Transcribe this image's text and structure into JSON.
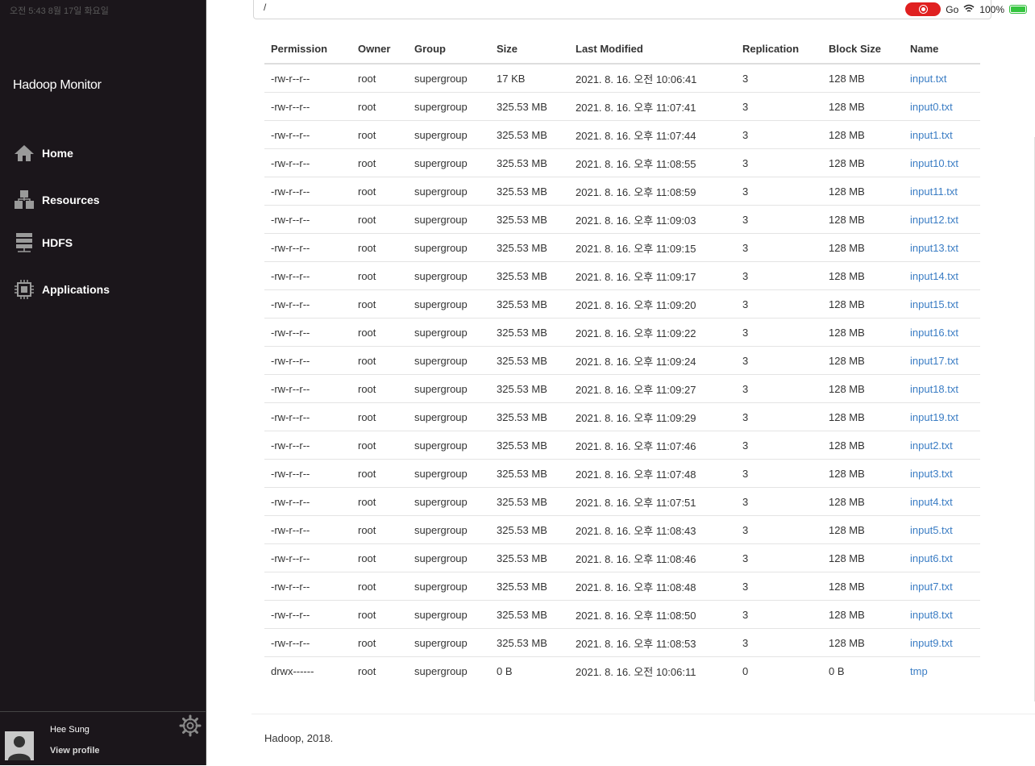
{
  "status_bar": {
    "time": "오전 5:43   8월 17일 화요일",
    "battery": "100%",
    "extra": "Go"
  },
  "sidebar": {
    "brand": "Hadoop Monitor",
    "items": [
      {
        "label": "Home",
        "icon": "home-icon"
      },
      {
        "label": "Resources",
        "icon": "cubes-icon"
      },
      {
        "label": "HDFS",
        "icon": "server-stack-icon"
      },
      {
        "label": "Applications",
        "icon": "chip-icon"
      }
    ],
    "profile": {
      "name": "Hee Sung",
      "link": "View profile"
    }
  },
  "path": "/",
  "table": {
    "headers": [
      "Permission",
      "Owner",
      "Group",
      "Size",
      "Last Modified",
      "Replication",
      "Block Size",
      "Name"
    ],
    "rows": [
      [
        "-rw-r--r--",
        "root",
        "supergroup",
        "17 KB",
        "2021. 8. 16. 오전 10:06:41",
        "3",
        "128 MB",
        "input.txt"
      ],
      [
        "-rw-r--r--",
        "root",
        "supergroup",
        "325.53 MB",
        "2021. 8. 16. 오후 11:07:41",
        "3",
        "128 MB",
        "input0.txt"
      ],
      [
        "-rw-r--r--",
        "root",
        "supergroup",
        "325.53 MB",
        "2021. 8. 16. 오후 11:07:44",
        "3",
        "128 MB",
        "input1.txt"
      ],
      [
        "-rw-r--r--",
        "root",
        "supergroup",
        "325.53 MB",
        "2021. 8. 16. 오후 11:08:55",
        "3",
        "128 MB",
        "input10.txt"
      ],
      [
        "-rw-r--r--",
        "root",
        "supergroup",
        "325.53 MB",
        "2021. 8. 16. 오후 11:08:59",
        "3",
        "128 MB",
        "input11.txt"
      ],
      [
        "-rw-r--r--",
        "root",
        "supergroup",
        "325.53 MB",
        "2021. 8. 16. 오후 11:09:03",
        "3",
        "128 MB",
        "input12.txt"
      ],
      [
        "-rw-r--r--",
        "root",
        "supergroup",
        "325.53 MB",
        "2021. 8. 16. 오후 11:09:15",
        "3",
        "128 MB",
        "input13.txt"
      ],
      [
        "-rw-r--r--",
        "root",
        "supergroup",
        "325.53 MB",
        "2021. 8. 16. 오후 11:09:17",
        "3",
        "128 MB",
        "input14.txt"
      ],
      [
        "-rw-r--r--",
        "root",
        "supergroup",
        "325.53 MB",
        "2021. 8. 16. 오후 11:09:20",
        "3",
        "128 MB",
        "input15.txt"
      ],
      [
        "-rw-r--r--",
        "root",
        "supergroup",
        "325.53 MB",
        "2021. 8. 16. 오후 11:09:22",
        "3",
        "128 MB",
        "input16.txt"
      ],
      [
        "-rw-r--r--",
        "root",
        "supergroup",
        "325.53 MB",
        "2021. 8. 16. 오후 11:09:24",
        "3",
        "128 MB",
        "input17.txt"
      ],
      [
        "-rw-r--r--",
        "root",
        "supergroup",
        "325.53 MB",
        "2021. 8. 16. 오후 11:09:27",
        "3",
        "128 MB",
        "input18.txt"
      ],
      [
        "-rw-r--r--",
        "root",
        "supergroup",
        "325.53 MB",
        "2021. 8. 16. 오후 11:09:29",
        "3",
        "128 MB",
        "input19.txt"
      ],
      [
        "-rw-r--r--",
        "root",
        "supergroup",
        "325.53 MB",
        "2021. 8. 16. 오후 11:07:46",
        "3",
        "128 MB",
        "input2.txt"
      ],
      [
        "-rw-r--r--",
        "root",
        "supergroup",
        "325.53 MB",
        "2021. 8. 16. 오후 11:07:48",
        "3",
        "128 MB",
        "input3.txt"
      ],
      [
        "-rw-r--r--",
        "root",
        "supergroup",
        "325.53 MB",
        "2021. 8. 16. 오후 11:07:51",
        "3",
        "128 MB",
        "input4.txt"
      ],
      [
        "-rw-r--r--",
        "root",
        "supergroup",
        "325.53 MB",
        "2021. 8. 16. 오후 11:08:43",
        "3",
        "128 MB",
        "input5.txt"
      ],
      [
        "-rw-r--r--",
        "root",
        "supergroup",
        "325.53 MB",
        "2021. 8. 16. 오후 11:08:46",
        "3",
        "128 MB",
        "input6.txt"
      ],
      [
        "-rw-r--r--",
        "root",
        "supergroup",
        "325.53 MB",
        "2021. 8. 16. 오후 11:08:48",
        "3",
        "128 MB",
        "input7.txt"
      ],
      [
        "-rw-r--r--",
        "root",
        "supergroup",
        "325.53 MB",
        "2021. 8. 16. 오후 11:08:50",
        "3",
        "128 MB",
        "input8.txt"
      ],
      [
        "-rw-r--r--",
        "root",
        "supergroup",
        "325.53 MB",
        "2021. 8. 16. 오후 11:08:53",
        "3",
        "128 MB",
        "input9.txt"
      ],
      [
        "drwx------",
        "root",
        "supergroup",
        "0 B",
        "2021. 8. 16. 오전 10:06:11",
        "0",
        "0 B",
        "tmp"
      ]
    ]
  },
  "footer": "Hadoop, 2018.",
  "colors": {
    "sidebar_bg": "#1b161b",
    "link": "#3b7dc4",
    "record": "#e02020",
    "battery": "#35c53f"
  }
}
